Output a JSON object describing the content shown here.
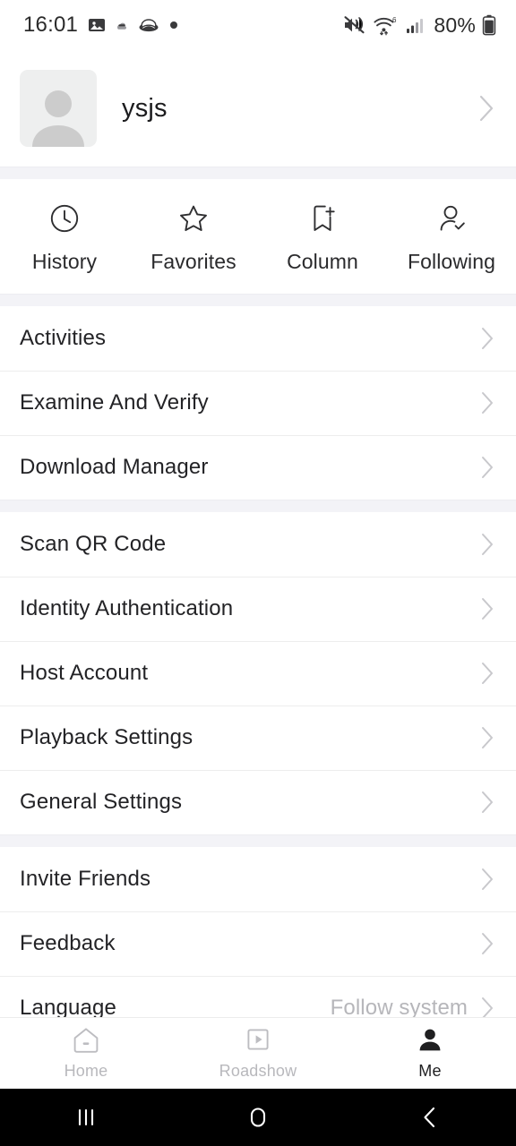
{
  "status_bar": {
    "clock": "16:01",
    "battery_text": "80%",
    "notification_icons": [
      "photo-icon",
      "cloud-small-icon",
      "hat-icon",
      "dot-icon"
    ],
    "system_icons": [
      "mute-icon",
      "wifi-6-icon",
      "cellular-signal-icon",
      "battery-icon"
    ]
  },
  "profile": {
    "name": "ysjs",
    "avatar_icon": "default-user-avatar-icon",
    "chevron_icon": "chevron-right-icon"
  },
  "quick_actions": [
    {
      "label": "History",
      "icon": "clock-icon"
    },
    {
      "label": "Favorites",
      "icon": "star-icon"
    },
    {
      "label": "Column",
      "icon": "bookmark-plus-icon"
    },
    {
      "label": "Following",
      "icon": "person-check-icon"
    }
  ],
  "menu_groups": [
    {
      "rows": [
        {
          "label": "Activities",
          "value": ""
        },
        {
          "label": "Examine And Verify",
          "value": ""
        },
        {
          "label": "Download Manager",
          "value": ""
        }
      ]
    },
    {
      "rows": [
        {
          "label": "Scan QR Code",
          "value": ""
        },
        {
          "label": "Identity Authentication",
          "value": ""
        },
        {
          "label": "Host Account",
          "value": ""
        },
        {
          "label": "Playback Settings",
          "value": ""
        },
        {
          "label": "General Settings",
          "value": ""
        }
      ]
    },
    {
      "rows": [
        {
          "label": "Invite Friends",
          "value": ""
        },
        {
          "label": "Feedback",
          "value": ""
        },
        {
          "label": "Language",
          "value": "Follow system"
        }
      ]
    }
  ],
  "tab_bar": [
    {
      "label": "Home",
      "icon": "home-icon",
      "active": false
    },
    {
      "label": "Roadshow",
      "icon": "play-square-icon",
      "active": false
    },
    {
      "label": "Me",
      "icon": "person-filled-icon",
      "active": true
    }
  ],
  "android_nav": [
    {
      "name": "recents-button",
      "icon": "recents-icon"
    },
    {
      "name": "home-button",
      "icon": "home-circle-icon"
    },
    {
      "name": "back-button",
      "icon": "chevron-left-icon"
    }
  ],
  "colors": {
    "background": "#ffffff",
    "band": "#f3f3f7",
    "primary_text": "#232326",
    "muted_text": "#b6b6ba",
    "chevron": "#c8c8cc",
    "nav_bar": "#000000"
  }
}
